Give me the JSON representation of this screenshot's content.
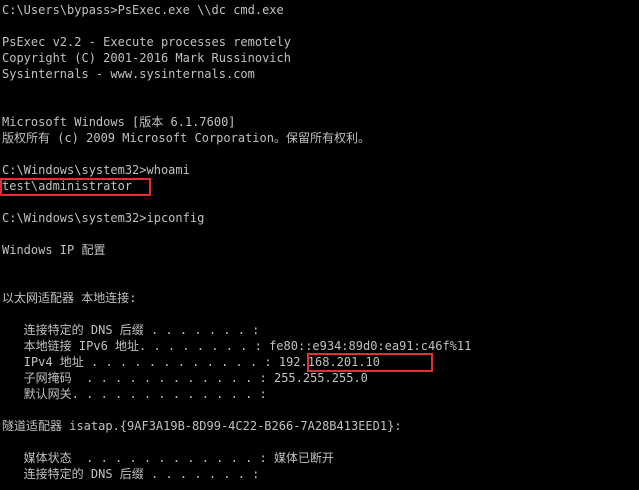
{
  "console": {
    "lines": [
      "C:\\Users\\bypass>PsExec.exe \\\\dc cmd.exe",
      "",
      "PsExec v2.2 - Execute processes remotely",
      "Copyright (C) 2001-2016 Mark Russinovich",
      "Sysinternals - www.sysinternals.com",
      "",
      "",
      "Microsoft Windows [版本 6.1.7600]",
      "版权所有 (c) 2009 Microsoft Corporation。保留所有权利。",
      "",
      "C:\\Windows\\system32>whoami",
      "test\\administrator",
      "",
      "C:\\Windows\\system32>ipconfig",
      "",
      "Windows IP 配置",
      "",
      "",
      "以太网适配器 本地连接:",
      "",
      "   连接特定的 DNS 后缀 . . . . . . . :",
      "   本地链接 IPv6 地址. . . . . . . . : fe80::e934:89d0:ea91:c46f%11",
      "   IPv4 地址 . . . . . . . . . . . . : 192.168.201.10",
      "   子网掩码  . . . . . . . . . . . . : 255.255.255.0",
      "   默认网关. . . . . . . . . . . . . :",
      "",
      "隧道适配器 isatap.{9AF3A19B-8D99-4C22-B266-7A28B413EED1}:",
      "",
      "   媒体状态  . . . . . . . . . . . . : 媒体已断开",
      "   连接特定的 DNS 后缀 . . . . . . . :"
    ]
  },
  "highlight_color": "#e03030",
  "text_color": "#c0c0c0",
  "background_color": "#000000"
}
